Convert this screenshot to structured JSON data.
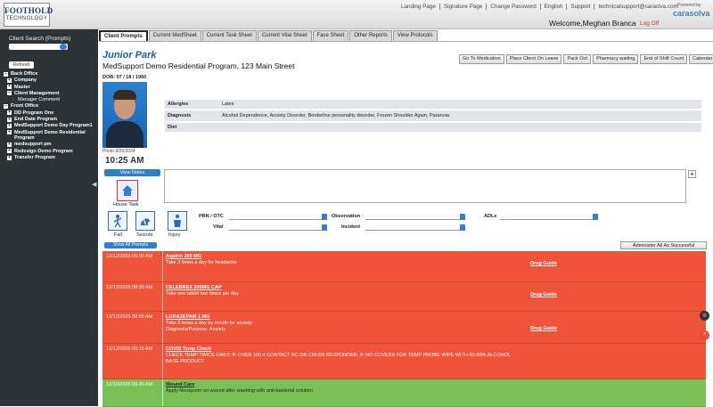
{
  "logo": {
    "line1": "FOOTHOLD",
    "line2": "TECHNOLOGY"
  },
  "top_links": [
    "Landing Page",
    "Signature Page",
    "Change Password",
    "English",
    "Support",
    "technicalsupport@caraclva.com"
  ],
  "powered_by": "Powered by",
  "brand": "carasolva",
  "welcome": "Welcome,Meghan Branca",
  "logoff": "Log Off",
  "sidebar": {
    "search_label": "Client Search (Prompts)",
    "refresh": "Refresh",
    "tree": [
      {
        "label": "Back Office",
        "level": 0
      },
      {
        "label": "Company",
        "level": 1
      },
      {
        "label": "Master",
        "level": 1
      },
      {
        "label": "Client Management",
        "level": 1
      },
      {
        "label": "Manager Comment",
        "level": 2
      },
      {
        "label": "Front Office",
        "level": 0
      },
      {
        "label": "DD Program One",
        "level": 1
      },
      {
        "label": "End Date Program",
        "level": 1
      },
      {
        "label": "MedSupport Demo Day Program1",
        "level": 1
      },
      {
        "label": "MedSupport Demo Residential Program",
        "level": 1
      },
      {
        "label": "medsupport pm",
        "level": 1
      },
      {
        "label": "Redesign Demo Program",
        "level": 1
      },
      {
        "label": "Transfer Program",
        "level": 1
      }
    ]
  },
  "tabs": [
    "Client Prompts",
    "Current MedSheet",
    "Current Task Sheet",
    "Current Vital Sheet",
    "Face Sheet",
    "Other Reports",
    "View Protocols"
  ],
  "client": {
    "name": "Junior Park",
    "program": "MedSupport Demo Residential Program, 123 Main Street",
    "dob": "DOB: 07 / 18 / 1960",
    "photo_date": "Photo 9/25/2024",
    "time": "10:25 AM"
  },
  "actions": [
    "Go To Medication",
    "Place Client On Leave",
    "Pack Out",
    "Pharmacy waiting",
    "End of Shift Count",
    "Calendar"
  ],
  "info": [
    {
      "key": "Allergies",
      "value": "Latex"
    },
    {
      "key": "Diagnosis",
      "value": "Alcohol Dependence, Anxiety Disorder, Borderline personality disorder, Frozen Shoulder Again, Paranoia"
    },
    {
      "key": "Diet",
      "value": ""
    }
  ],
  "buttons": {
    "view_notes": "View Notes",
    "show_all": "Show All Prompts",
    "administer_all": "Administer All As Successful",
    "add": "+"
  },
  "house_task": "House Task",
  "quick_icons": [
    "Fall",
    "Seizure",
    "Injury"
  ],
  "filters": {
    "prn": "PRN / OTC",
    "vital": "Vital",
    "observation": "Observation",
    "incident": "Incident",
    "adls": "ADLs"
  },
  "tasks": [
    {
      "time": "12/12/2025 06:00 AM",
      "title": "Aspirin 300 MG",
      "desc": [
        "Take 3 times a day for headache"
      ],
      "drug_guide": "Drug Guide",
      "color": "red"
    },
    {
      "time": "12/12/2025 08:00 AM",
      "title": "CELEBREX 200MG CAP",
      "desc": [
        "Take one tablet two times per day"
      ],
      "drug_guide": "Drug Guide",
      "color": "red"
    },
    {
      "time": "12/12/2025 08:00 AM",
      "title": "LORAZEPAM 1 MG",
      "desc": [
        "Take 3 times a day by mouth for anxiety",
        "Diagnosis/Purpose: Anxiety"
      ],
      "drug_guide": "Drug Guide",
      "color": "red"
    },
    {
      "time": "12/12/2025 09:15 AM",
      "title": "COVID Temp Check",
      "desc": [
        "CHECK TEMP TWICE DAILY. IF OVER 100.4 CONTACT RC OR CRISIS RESPONDER. IF NO COVERS FOR TEMP PROBE WIPE WITH 60-90% ALCOHOL",
        "BASE PRODUCT"
      ],
      "drug_guide": "",
      "color": "red"
    },
    {
      "time": "12/12/2025 09:30 AM",
      "title": "Wound Care",
      "desc": [
        "Apply Neosporin on wound after washing with anti-bacterial solution"
      ],
      "drug_guide": "",
      "color": "green"
    }
  ],
  "colors": {
    "red_row": "#ef533a",
    "green_row": "#7ac057",
    "accent": "#2f7fc8",
    "sidebar": "#2b3238"
  }
}
